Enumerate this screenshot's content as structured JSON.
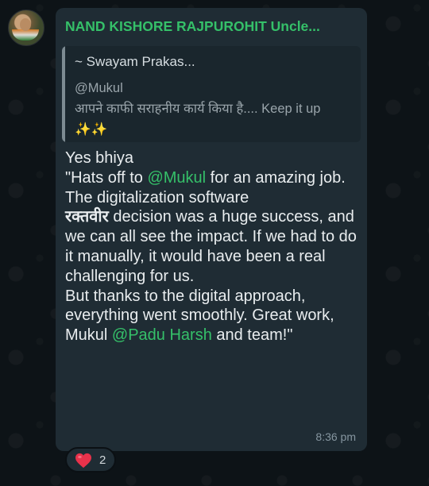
{
  "message": {
    "sender": "NAND KISHORE RAJPUROHIT Uncle...",
    "quoted": {
      "author": "~ Swayam Prakas...",
      "text": "@Mukul\nआपने काफी सराहनीय कार्य किया है.... Keep it up ✨✨"
    },
    "body": {
      "part1": "Yes bhiya\n\"Hats off to ",
      "mention1": "@Mukul",
      "part2": " for an amazing job. The digitalization software",
      "bold_word": "रक्तवीर",
      "part3": " decision was a huge success, and we can all see the impact. If we had to do it manually, it would have been a real challenging for us.\nBut thanks to the digital approach, everything went smoothly. Great work, Mukul  ",
      "mention2": "@Padu Harsh",
      "part4": " and team!\""
    },
    "time": "8:36 pm",
    "reaction": {
      "emoji": "heart-icon",
      "count": "2"
    }
  }
}
